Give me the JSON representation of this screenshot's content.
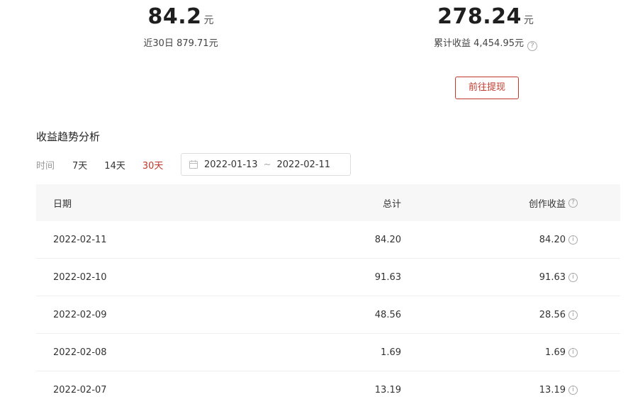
{
  "stats": {
    "yesterday": {
      "value": "84.2",
      "unit": "元",
      "sub": "近30日 879.71元"
    },
    "balance": {
      "value": "278.24",
      "unit": "元",
      "sub": "累计收益 4,454.95元"
    }
  },
  "withdraw_button": "前往提现",
  "trend": {
    "title": "收益趋势分析",
    "filter_label": "时间",
    "options": [
      "7天",
      "14天",
      "30天"
    ],
    "active_option": "30天",
    "date_start": "2022-01-13",
    "date_sep": "~",
    "date_end": "2022-02-11"
  },
  "table": {
    "headers": {
      "date": "日期",
      "total": "总计",
      "earn": "创作收益"
    },
    "rows": [
      {
        "date": "2022-02-11",
        "total": "84.20",
        "earn": "84.20"
      },
      {
        "date": "2022-02-10",
        "total": "91.63",
        "earn": "91.63"
      },
      {
        "date": "2022-02-09",
        "total": "48.56",
        "earn": "28.56"
      },
      {
        "date": "2022-02-08",
        "total": "1.69",
        "earn": "1.69"
      },
      {
        "date": "2022-02-07",
        "total": "13.19",
        "earn": "13.19"
      }
    ]
  },
  "icons": {
    "help": "question-circle-icon",
    "info": "info-circle-icon",
    "calendar": "calendar-icon"
  },
  "colors": {
    "accent": "#c0392b"
  }
}
